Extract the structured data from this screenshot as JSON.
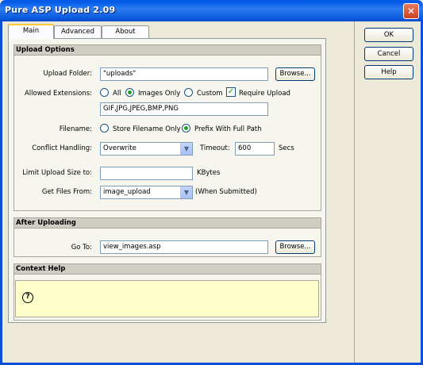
{
  "window": {
    "title": "Pure ASP Upload 2.09"
  },
  "tabs": [
    {
      "label": "Main"
    },
    {
      "label": "Advanced"
    },
    {
      "label": "About"
    }
  ],
  "upload_options": {
    "header": "Upload Options",
    "upload_folder": {
      "label": "Upload Folder:",
      "value": "\"uploads\"",
      "browse": "Browse..."
    },
    "allowed_extensions": {
      "label": "Allowed Extensions:",
      "opt_all": "All",
      "opt_images": "Images Only",
      "opt_custom": "Custom",
      "selected": "Images Only",
      "require_upload": "Require Upload",
      "require_checked": true,
      "ext_value": "GIF,JPG,JPEG,BMP,PNG"
    },
    "filename": {
      "label": "Filename:",
      "opt_store": "Store Filename Only",
      "opt_prefix": "Prefix With Full Path",
      "selected": "Prefix With Full Path"
    },
    "conflict": {
      "label": "Conflict Handling:",
      "value": "Overwrite",
      "timeout_label": "Timeout:",
      "timeout_value": "600",
      "timeout_unit": "Secs"
    },
    "limit": {
      "label": "Limit Upload Size to:",
      "value": "",
      "unit": "KBytes"
    },
    "get_files": {
      "label": "Get Files From:",
      "value": "image_upload",
      "note": "(When Submitted)"
    }
  },
  "after_uploading": {
    "header": "After Uploading",
    "goto": {
      "label": "Go To:",
      "value": "view_images.asp",
      "browse": "Browse..."
    }
  },
  "context_help": {
    "header": "Context Help",
    "icon": "question-icon"
  },
  "buttons": {
    "ok": "OK",
    "cancel": "Cancel",
    "help": "Help"
  },
  "colors": {
    "title_bar": "#0a5ae0",
    "face": "#ece9d8",
    "help_bg": "#ffffcc",
    "accent_radio": "#21a121"
  }
}
